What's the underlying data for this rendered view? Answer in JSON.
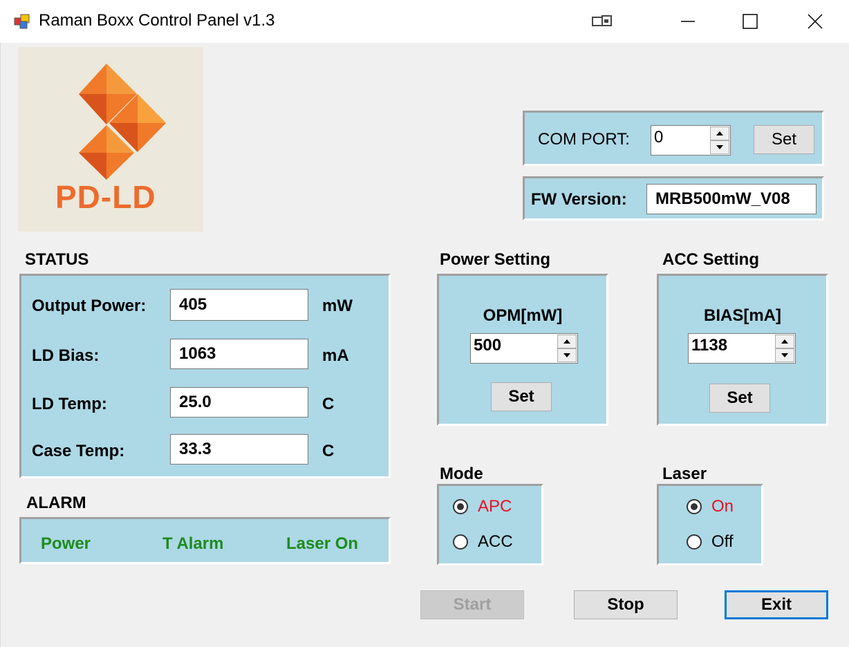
{
  "window": {
    "title": "Raman Boxx Control Panel v1.3"
  },
  "logo": {
    "text": "PD-LD",
    "brand_color": "#ec6b2d"
  },
  "com_port": {
    "label": "COM PORT:",
    "value": "0",
    "set_label": "Set"
  },
  "fw": {
    "label": "FW Version:",
    "value": "MRB500mW_V08"
  },
  "status": {
    "title": "STATUS",
    "rows": [
      {
        "label": "Output Power:",
        "value": "405",
        "unit": "mW"
      },
      {
        "label": "LD Bias:",
        "value": "1063",
        "unit": "mA"
      },
      {
        "label": "LD Temp:",
        "value": "25.0",
        "unit": "C"
      },
      {
        "label": "Case Temp:",
        "value": "33.3",
        "unit": "C"
      }
    ]
  },
  "alarm": {
    "title": "ALARM",
    "items": [
      "Power",
      "T Alarm",
      "Laser On"
    ],
    "color": "#1e8c1e"
  },
  "power_setting": {
    "title": "Power Setting",
    "field_label": "OPM[mW]",
    "value": "500",
    "set_label": "Set"
  },
  "acc_setting": {
    "title": "ACC Setting",
    "field_label": "BIAS[mA]",
    "value": "1138",
    "set_label": "Set"
  },
  "mode": {
    "title": "Mode",
    "options": [
      {
        "label": "APC",
        "selected": true
      },
      {
        "label": "ACC",
        "selected": false
      }
    ]
  },
  "laser": {
    "title": "Laser",
    "options": [
      {
        "label": "On",
        "selected": true
      },
      {
        "label": "Off",
        "selected": false
      }
    ]
  },
  "buttons": {
    "start": "Start",
    "stop": "Stop",
    "exit": "Exit"
  },
  "colors": {
    "panel": "#add8e6",
    "selected_text": "#e81123",
    "focus": "#0078d7"
  }
}
